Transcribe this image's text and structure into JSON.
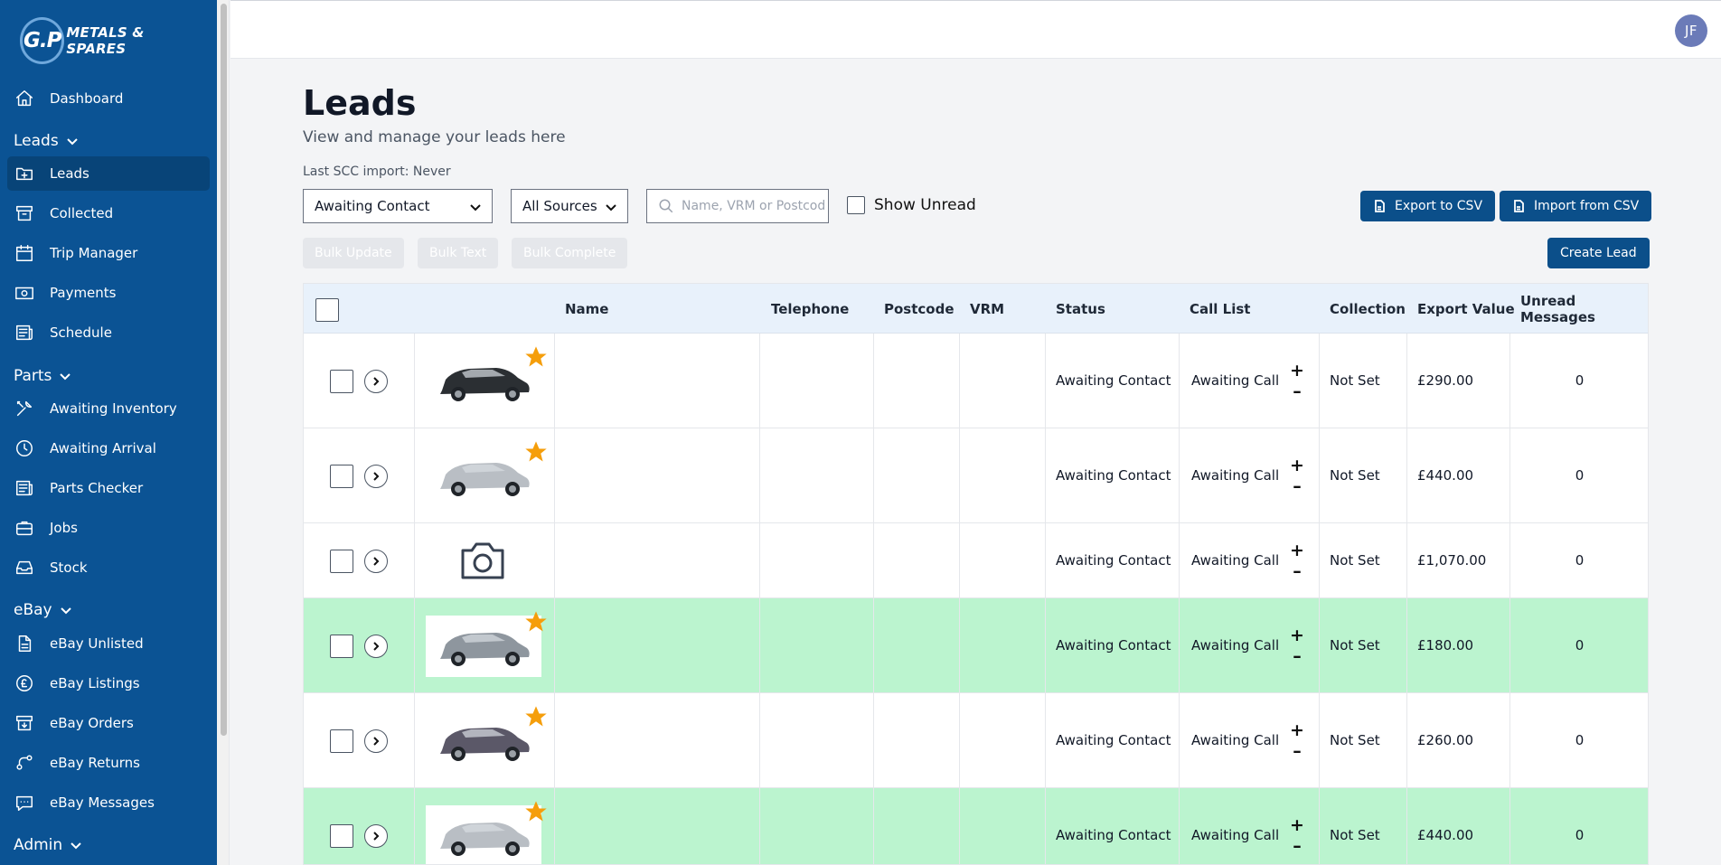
{
  "sidebar": {
    "logo_mark": "G.P",
    "logo_text": "METALS & SPARES",
    "items": [
      {
        "label": "Dashboard"
      },
      {
        "label": "Leads"
      },
      {
        "label": "Collected"
      },
      {
        "label": "Trip Manager"
      },
      {
        "label": "Payments"
      },
      {
        "label": "Schedule"
      },
      {
        "label": "Awaiting Inventory"
      },
      {
        "label": "Awaiting Arrival"
      },
      {
        "label": "Parts Checker"
      },
      {
        "label": "Jobs"
      },
      {
        "label": "Stock"
      },
      {
        "label": "eBay Unlisted"
      },
      {
        "label": "eBay Listings"
      },
      {
        "label": "eBay Orders"
      },
      {
        "label": "eBay Returns"
      },
      {
        "label": "eBay Messages"
      }
    ],
    "sections": {
      "leads": "Leads",
      "parts": "Parts",
      "ebay": "eBay",
      "admin": "Admin"
    },
    "active_item": "Leads",
    "colors": {
      "background": "#0b5394",
      "active": "#084478"
    }
  },
  "topbar": {
    "avatar_initials": "JF"
  },
  "page": {
    "title": "Leads",
    "subtitle": "View and manage your leads here",
    "import_info": "Last SCC import: Never"
  },
  "filters": {
    "status_value": "Awaiting Contact",
    "source_value": "All Sources",
    "search_placeholder": "Name, VRM or Postcode",
    "show_unread_label": "Show Unread"
  },
  "actions": {
    "export_csv": "Export to CSV",
    "import_csv": "Import from CSV",
    "bulk_update": "Bulk Update",
    "bulk_text": "Bulk Text",
    "bulk_complete": "Bulk Complete",
    "create_lead": "Create Lead"
  },
  "table": {
    "columns": [
      "Name",
      "Telephone",
      "Postcode",
      "VRM",
      "Status",
      "Call List",
      "Collection",
      "Export Value",
      "Unread Messages"
    ],
    "rows": [
      {
        "image": "car-dark",
        "starred": true,
        "highlight": false,
        "name": "",
        "telephone": "",
        "postcode": "",
        "vrm": "",
        "status": "Awaiting Contact",
        "call_list": "Awaiting Call",
        "collection": "Not Set",
        "export_value": "£290.00",
        "unread": "0"
      },
      {
        "image": "car-silver",
        "starred": true,
        "highlight": false,
        "name": "",
        "telephone": "",
        "postcode": "",
        "vrm": "",
        "status": "Awaiting Contact",
        "call_list": "Awaiting Call",
        "collection": "Not Set",
        "export_value": "£440.00",
        "unread": "0"
      },
      {
        "image": "camera",
        "starred": false,
        "highlight": false,
        "name": "",
        "telephone": "",
        "postcode": "",
        "vrm": "",
        "status": "Awaiting Contact",
        "call_list": "Awaiting Call",
        "collection": "Not Set",
        "export_value": "£1,070.00",
        "unread": "0"
      },
      {
        "image": "car-grey",
        "starred": true,
        "highlight": true,
        "name": "",
        "telephone": "",
        "postcode": "",
        "vrm": "",
        "status": "Awaiting Contact",
        "call_list": "Awaiting Call",
        "collection": "Not Set",
        "export_value": "£180.00",
        "unread": "0"
      },
      {
        "image": "car-purple",
        "starred": true,
        "highlight": false,
        "name": "",
        "telephone": "",
        "postcode": "",
        "vrm": "",
        "status": "Awaiting Contact",
        "call_list": "Awaiting Call",
        "collection": "Not Set",
        "export_value": "£260.00",
        "unread": "0"
      },
      {
        "image": "car-silver",
        "starred": true,
        "highlight": true,
        "name": "",
        "telephone": "",
        "postcode": "",
        "vrm": "",
        "status": "Awaiting Contact",
        "call_list": "Awaiting Call",
        "collection": "Not Set",
        "export_value": "£440.00",
        "unread": "0"
      }
    ]
  },
  "colors": {
    "accent": "#0b4f8a",
    "row_highlight": "#bbf4cf",
    "header_bg": "#e8f1fb",
    "star": "#f59e0b"
  }
}
